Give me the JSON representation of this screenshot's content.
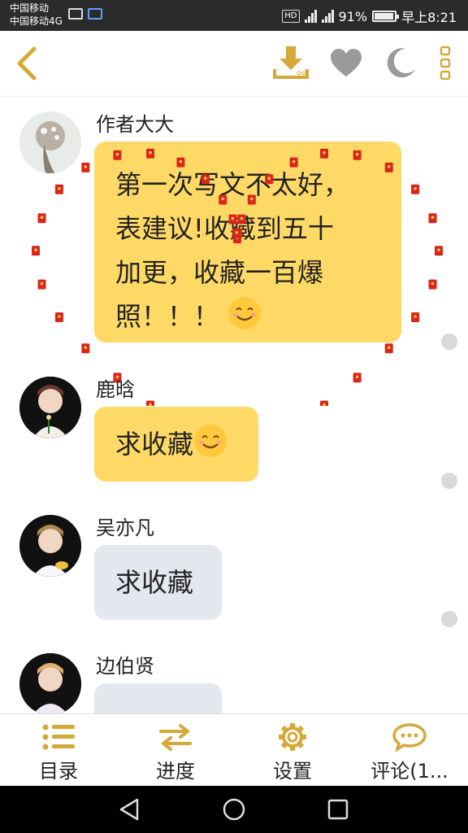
{
  "status": {
    "carrier_line1": "中国移动",
    "carrier_line2": "中国移动4G",
    "hd": "HD",
    "battery": "91%",
    "time": "早上8:21"
  },
  "toolbar": {
    "back_icon": "chevron-left-icon",
    "download_icon": "download-icon",
    "favorite_icon": "heart-icon",
    "night_icon": "moon-icon",
    "more_icon": "more-vertical-icon",
    "accent": "#d4a93a"
  },
  "messages": [
    {
      "name": "作者大大",
      "line1": "第一次写文不太好，",
      "line2": "表建议!收藏到五十",
      "line3": "加更，收藏一百爆",
      "line4": "照！！！",
      "style": "yellow"
    },
    {
      "name": "鹿晗",
      "text": "求收藏",
      "style": "yellow"
    },
    {
      "name": "吴亦凡",
      "text": "求收藏",
      "style": "gray"
    },
    {
      "name": "边伯贤",
      "text": "",
      "style": "gray"
    }
  ],
  "bottom_nav": [
    {
      "label": "目录",
      "icon": "list-icon"
    },
    {
      "label": "进度",
      "icon": "swap-arrows-icon"
    },
    {
      "label": "设置",
      "icon": "gear-icon"
    },
    {
      "label": "评论(1...",
      "icon": "comment-icon"
    }
  ],
  "colors": {
    "bubble_yellow": "#ffd966",
    "bubble_gray": "#e3e8ef",
    "icon_gold": "#d4a93a",
    "icon_gray": "#9a9a9a",
    "red_packet": "#d9261c"
  }
}
